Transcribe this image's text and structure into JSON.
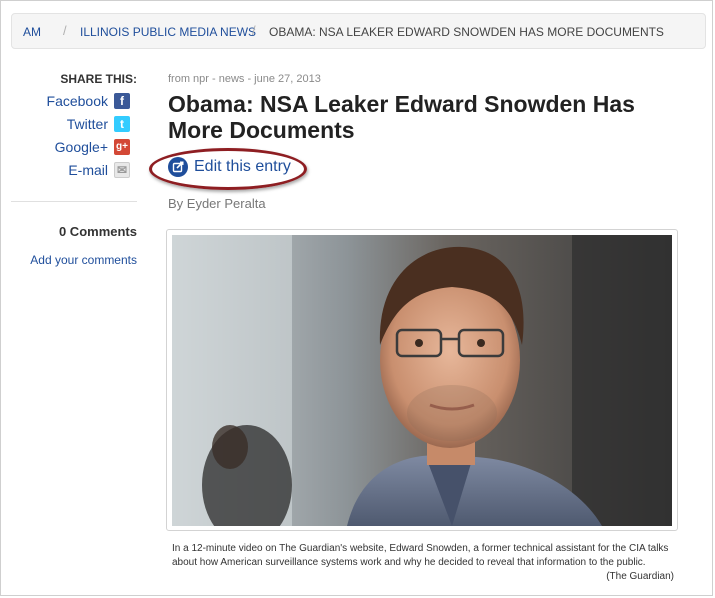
{
  "breadcrumb": {
    "items": [
      "AM",
      "ILLINOIS PUBLIC MEDIA NEWS",
      "OBAMA: NSA LEAKER EDWARD SNOWDEN HAS MORE DOCUMENTS"
    ],
    "separator": "/"
  },
  "sidebar": {
    "share_title": "SHARE THIS:",
    "share_items": [
      {
        "label": "Facebook",
        "icon": "facebook-icon",
        "icon_glyph": "f",
        "color": "#3b5998"
      },
      {
        "label": "Twitter",
        "icon": "twitter-icon",
        "icon_glyph": "t",
        "color": "#33ccff"
      },
      {
        "label": "Google+",
        "icon": "google-plus-icon",
        "icon_glyph": "g+",
        "color": "#d34836"
      },
      {
        "label": "E-mail",
        "icon": "email-icon",
        "icon_glyph": "✉",
        "color": "#cccccc"
      }
    ],
    "comments_count": "0 Comments",
    "add_comments": "Add your comments"
  },
  "article": {
    "meta": "from npr - news - june 27, 2013",
    "title": "Obama: NSA Leaker Edward Snowden Has More Documents",
    "edit_link": "Edit this entry",
    "byline": "By Eyder Peralta",
    "caption": "In a 12-minute video on The Guardian's website, Edward Snowden, a former technical assistant for the CIA talks about how American surveillance systems work and why he decided to reveal that information to the public.",
    "caption_credit": "(The Guardian)"
  },
  "colors": {
    "link": "#1f4e9b",
    "annotation_ellipse": "#8e1e22"
  }
}
